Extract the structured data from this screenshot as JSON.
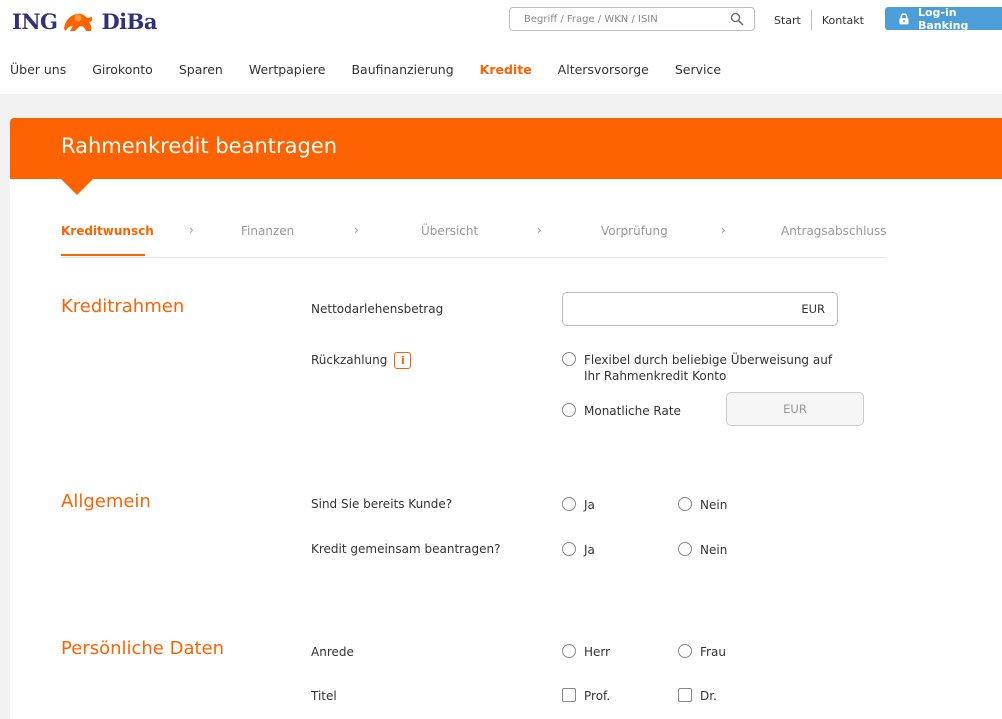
{
  "header": {
    "logo_left": "ING",
    "logo_right": "DiBa",
    "search_placeholder": "Begriff / Frage / WKN / ISIN",
    "links": [
      "Start",
      "Kontakt"
    ],
    "login_label": "Log-in Banking"
  },
  "nav": {
    "items": [
      {
        "label": "Über uns",
        "active": false
      },
      {
        "label": "Girokonto",
        "active": false
      },
      {
        "label": "Sparen",
        "active": false
      },
      {
        "label": "Wertpapiere",
        "active": false
      },
      {
        "label": "Baufinanzierung",
        "active": false
      },
      {
        "label": "Kredite",
        "active": true
      },
      {
        "label": "Altersvorsorge",
        "active": false
      },
      {
        "label": "Service",
        "active": false
      }
    ]
  },
  "page": {
    "title": "Rahmenkredit beantragen"
  },
  "steps": {
    "items": [
      "Kreditwunsch",
      "Finanzen",
      "Übersicht",
      "Vorprüfung",
      "Antragsabschluss"
    ],
    "active": "Kreditwunsch",
    "separator": "›"
  },
  "kreditrahmen": {
    "title": "Kreditrahmen",
    "amount_label": "Nettodarlehensbetrag",
    "amount_value": "",
    "amount_unit": "EUR",
    "repayment_label": "Rückzahlung",
    "info_icon": "i",
    "option_flexible_line1": "Flexibel durch beliebige Überweisung auf",
    "option_flexible_line2": "Ihr Rahmenkredit Konto",
    "option_monthly": "Monatliche Rate",
    "monthly_unit": "EUR"
  },
  "allgemein": {
    "title": "Allgemein",
    "customer_label": "Sind Sie bereits Kunde?",
    "joint_label": "Kredit gemeinsam beantragen?",
    "yes": "Ja",
    "no": "Nein"
  },
  "persoenlich": {
    "title": "Persönliche Daten",
    "salutation_label": "Anrede",
    "mr": "Herr",
    "mrs": "Frau",
    "title_label": "Titel",
    "prof": "Prof.",
    "dr": "Dr."
  },
  "colors": {
    "accent": "#ff6200",
    "login_blue": "#4c9ed9",
    "logo_navy": "#33307a"
  }
}
